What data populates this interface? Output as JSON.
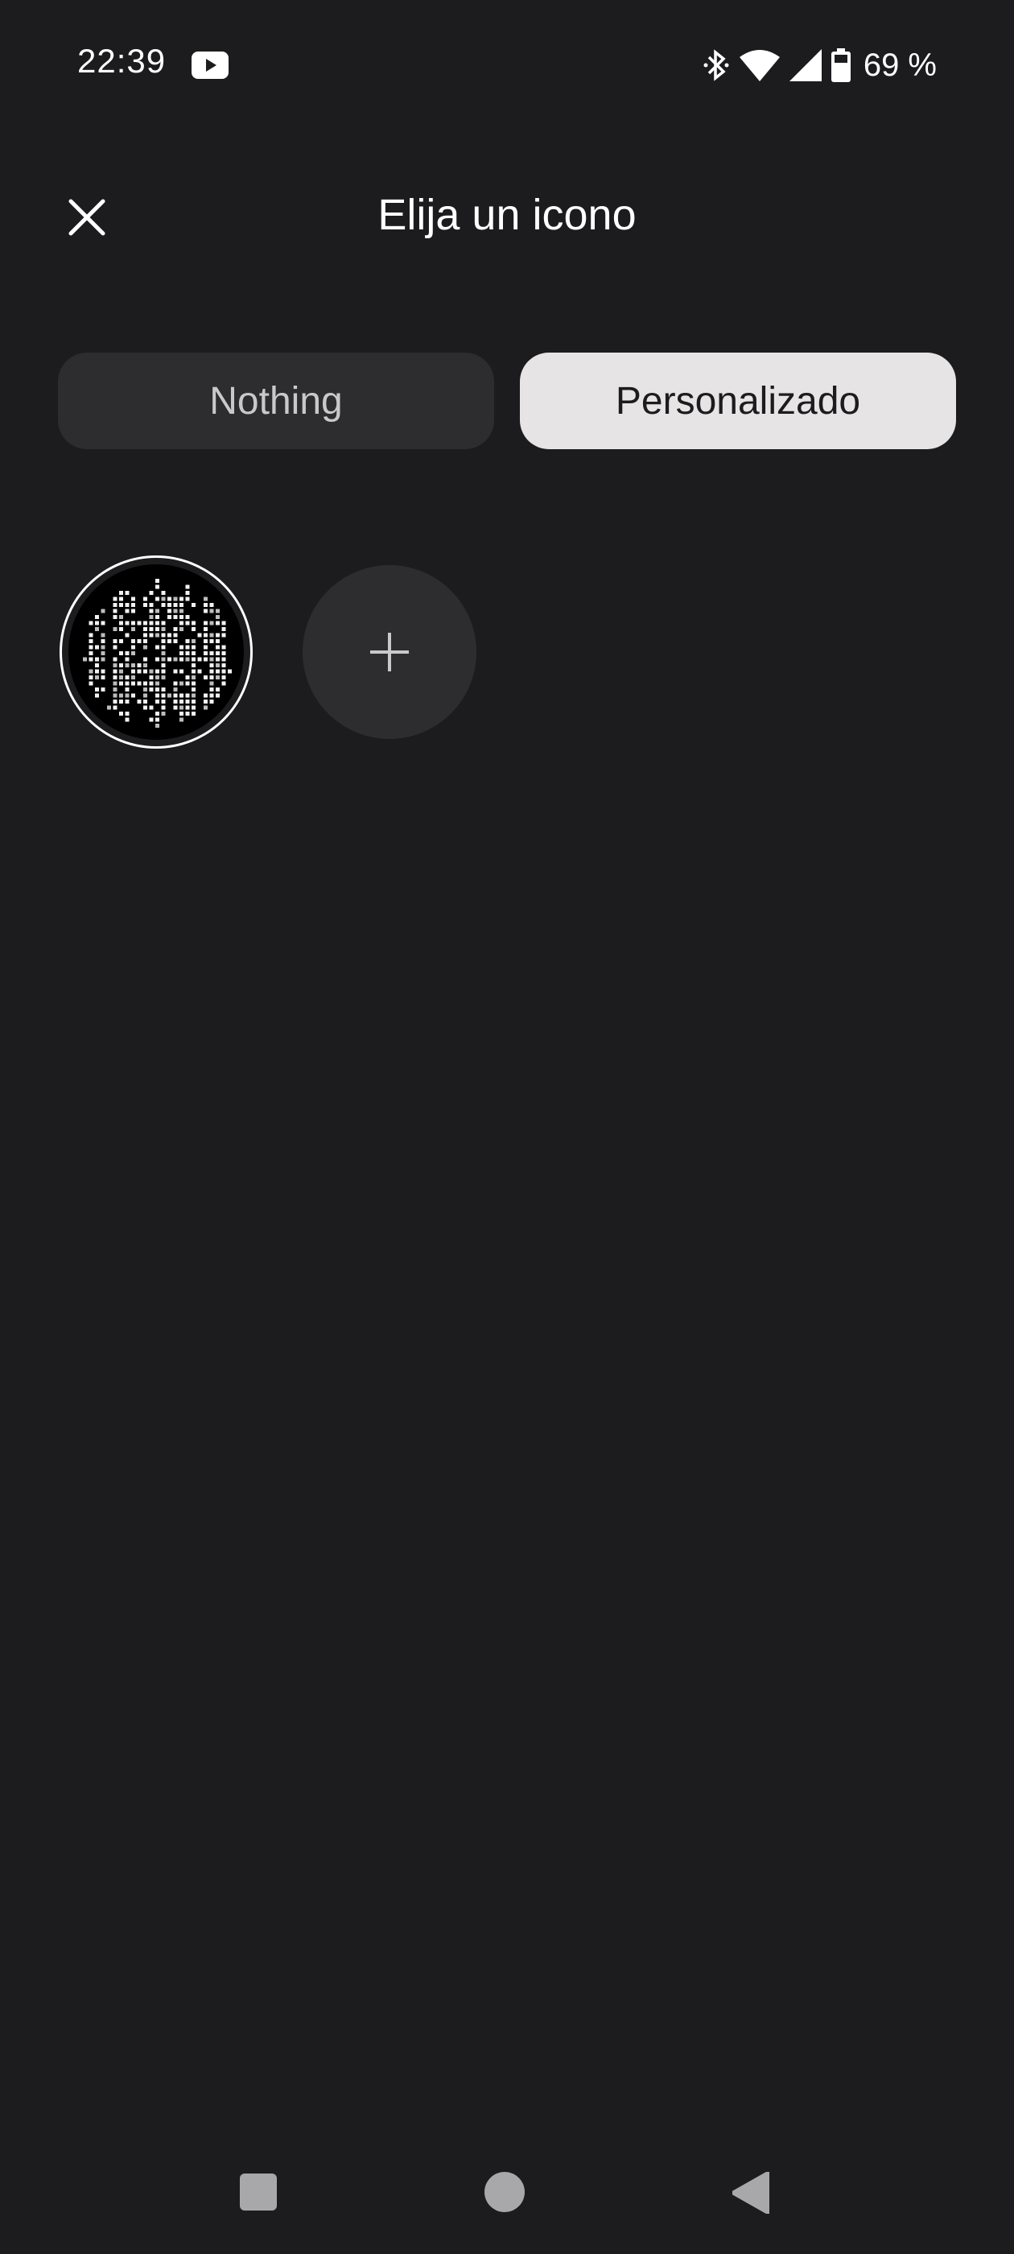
{
  "status_bar": {
    "time": "22:39",
    "battery": "69 %",
    "icons": [
      "youtube-icon",
      "bluetooth-icon",
      "wifi-icon",
      "cell-signal-icon",
      "battery-icon"
    ]
  },
  "header": {
    "title": "Elija un icono",
    "close_icon": "close-icon"
  },
  "tabs": [
    {
      "label": "Nothing",
      "selected": false
    },
    {
      "label": "Personalizado",
      "selected": true
    }
  ],
  "icons": {
    "selected_icon": "custom-dot-matrix-icon",
    "add_icon": "plus-icon"
  },
  "nav": {
    "recents": "recents-icon",
    "home": "home-icon",
    "back": "back-icon"
  },
  "colors": {
    "background": "#1c1c1e",
    "tab_inactive": "#2d2d2f",
    "tab_active": "#e6e4e5",
    "accent_text": "#ffffff"
  }
}
